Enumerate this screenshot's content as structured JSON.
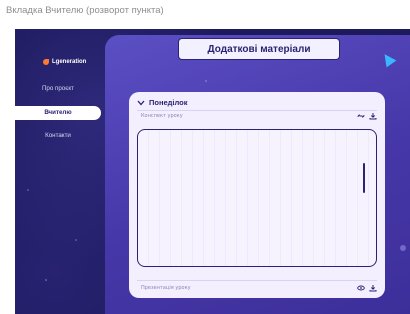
{
  "frame_caption": "Вкладка Вчителю (розворот пункта)",
  "logo": {
    "text": "Lgeneration"
  },
  "nav": {
    "items": [
      {
        "label": "Про проєкт",
        "active": false
      },
      {
        "label": "Вчителю",
        "active": true
      },
      {
        "label": "Контакти",
        "active": false
      }
    ]
  },
  "main": {
    "title": "Додаткові матеріали",
    "section": {
      "day": "Понеділок",
      "lesson_label": "Конспект уроку",
      "presentation_label": "Презентація уроку"
    }
  },
  "colors": {
    "background": "#1d1a5c",
    "main_panel": "#4637a8",
    "card": "#f3efff",
    "text_dark": "#2a2470",
    "accent_orange": "#ff7a2e",
    "accent_blue": "#39b7ff"
  },
  "icons": [
    "logo-mark-icon",
    "chevron-down-icon",
    "link-icon",
    "download-icon",
    "eye-icon",
    "cursor-icon"
  ]
}
